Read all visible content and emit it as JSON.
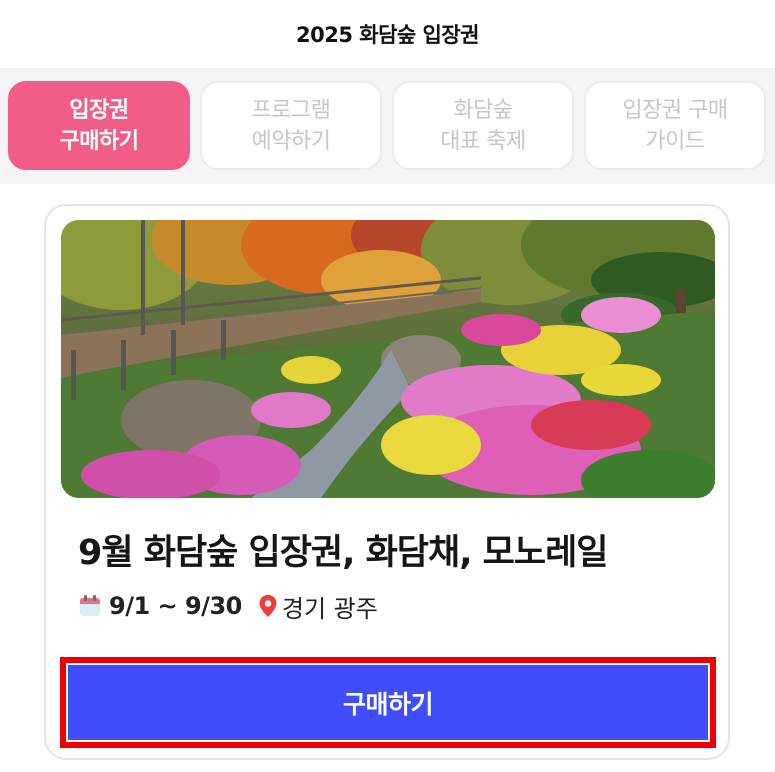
{
  "header": {
    "title": "2025 화담숲 입장권"
  },
  "tabs": [
    {
      "line1": "입장권",
      "line2": "구매하기",
      "active": true
    },
    {
      "line1": "프로그램",
      "line2": "예약하기",
      "active": false
    },
    {
      "line1": "화담숲",
      "line2": "대표 축제",
      "active": false
    },
    {
      "line1": "입장권 구매",
      "line2": "가이드",
      "active": false
    }
  ],
  "product": {
    "title": "9월 화담숲 입장권, 화담채, 모노레일",
    "date_range": "9/1 ~ 9/30",
    "location": "경기 광주",
    "calendar_icon": "calendar-icon",
    "location_icon": "location-pin-icon"
  },
  "buy_button": {
    "label": "구매하기"
  },
  "colors": {
    "active_tab": "#f25d87",
    "buy_button": "#3f4dfb",
    "highlight_border": "#ee0000"
  }
}
